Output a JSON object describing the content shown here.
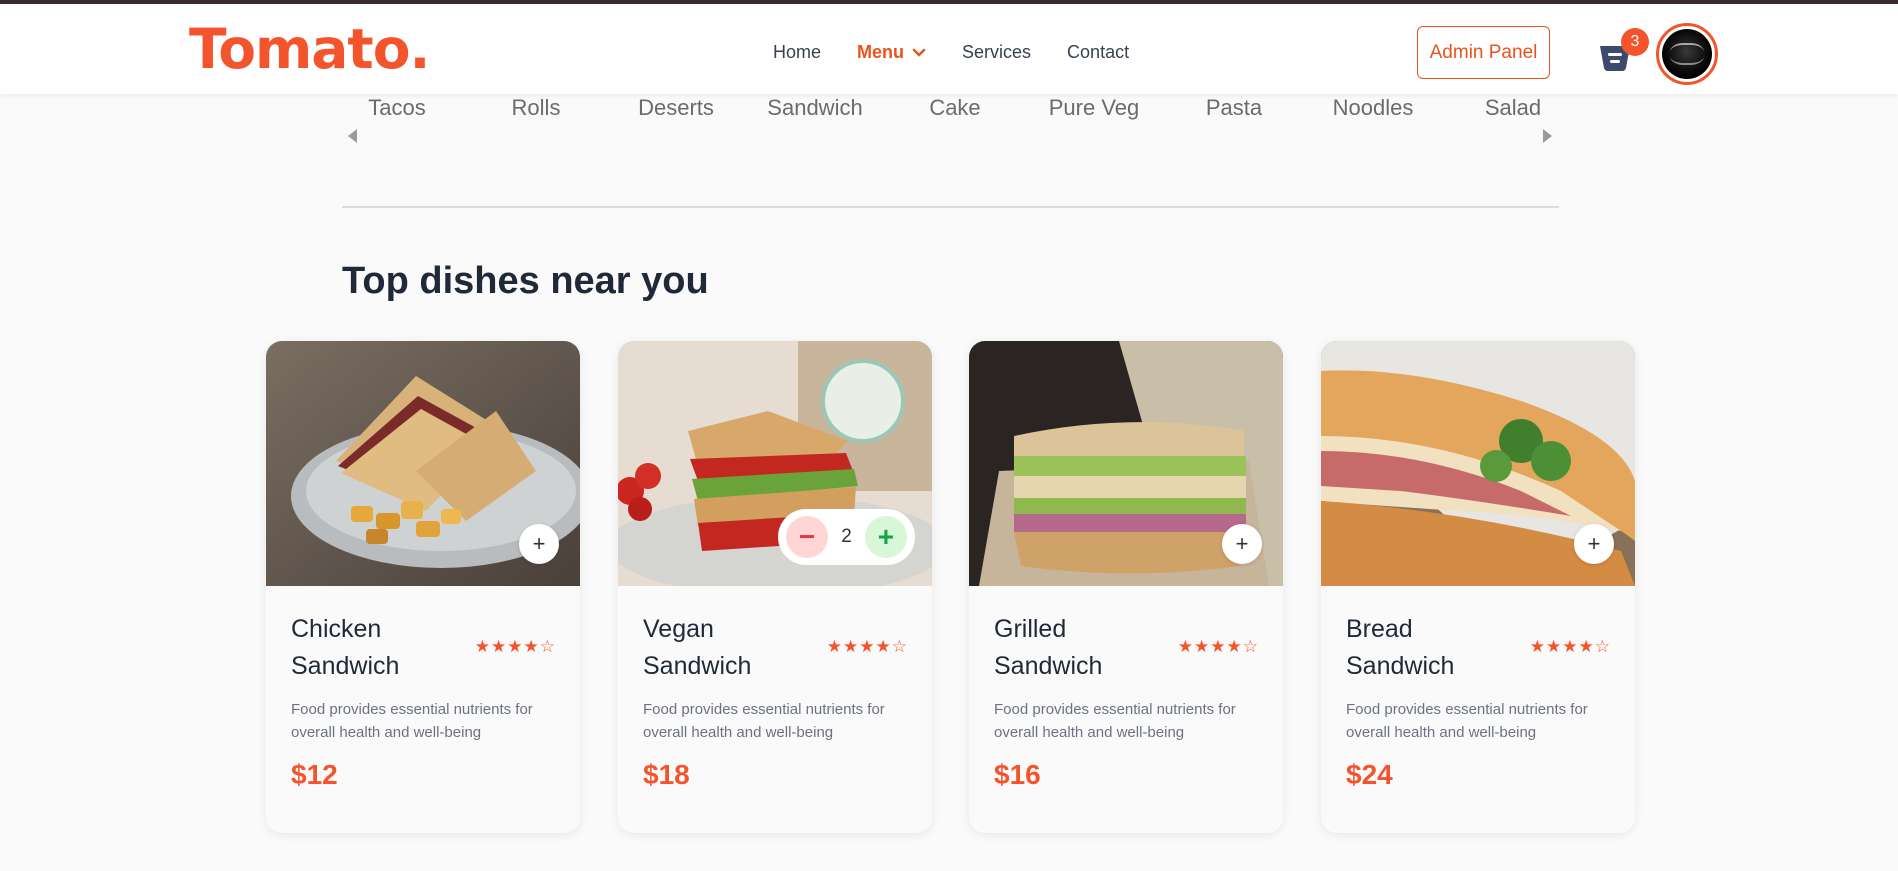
{
  "header": {
    "logo": "Tomato.",
    "nav": [
      "Home",
      "Menu",
      "Services",
      "Contact"
    ],
    "active_nav": "Menu",
    "admin_label": "Admin Panel",
    "cart_count": "3"
  },
  "categories": [
    "Tacos",
    "Rolls",
    "Deserts",
    "Sandwich",
    "Cake",
    "Pure Veg",
    "Pasta",
    "Noodles",
    "Salad"
  ],
  "section_title": "Top dishes near you",
  "dishes": [
    {
      "name": "Chicken Sandwich",
      "rating": 4,
      "description": "Food provides essential nutrients for overall health and well-being",
      "price": "$12",
      "in_cart": false
    },
    {
      "name": "Vegan Sandwich",
      "rating": 4,
      "description": "Food provides essential nutrients for overall health and well-being",
      "price": "$18",
      "in_cart": true,
      "quantity": "2"
    },
    {
      "name": "Grilled Sandwich",
      "rating": 4,
      "description": "Food provides essential nutrients for overall health and well-being",
      "price": "$16",
      "in_cart": false
    },
    {
      "name": "Bread Sandwich",
      "rating": 4,
      "description": "Food provides essential nutrients for overall health and well-being",
      "price": "$24",
      "in_cart": false
    }
  ],
  "colors": {
    "accent": "#f4542b",
    "menu_active": "#e8541c",
    "minus_bg": "#ffd6d6",
    "plus_bg": "#d7f7d7"
  },
  "icons": {
    "cart": "basket-icon",
    "add": "plus-icon",
    "dropdown": "chevron-down-icon",
    "star_full": "star-icon",
    "star_empty": "star-outline-icon"
  }
}
